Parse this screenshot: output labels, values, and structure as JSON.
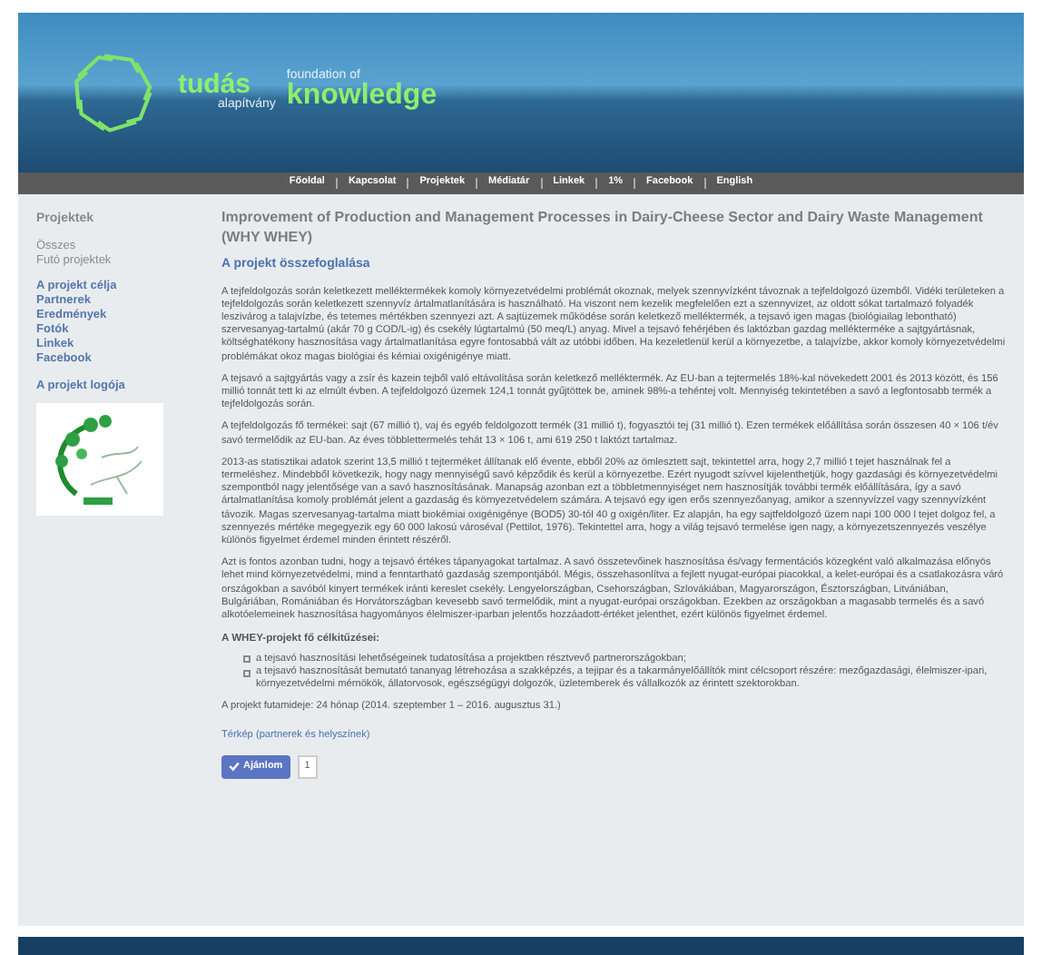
{
  "header": {
    "logo": {
      "word_1": "tudás",
      "word_2": "alapítvány",
      "word_3": "foundation of",
      "word_4": "knowledge"
    }
  },
  "nav": [
    {
      "label": "Főoldal"
    },
    {
      "label": "Kapcsolat"
    },
    {
      "label": "Projektek"
    },
    {
      "label": "Médiatár"
    },
    {
      "label": "Linkek"
    },
    {
      "label": "1%"
    },
    {
      "label": "Facebook"
    },
    {
      "label": "English"
    }
  ],
  "sidebar": {
    "title": "Projektek",
    "groups": [
      [
        "Összes",
        "Futó projektek"
      ],
      [
        "A projekt célja",
        "Partnerek",
        "Eredmények",
        "Fotók",
        "Linkek",
        "Facebook"
      ]
    ],
    "logo_title": "A projekt logója"
  },
  "article": {
    "title": "Improvement of Production and Management Processes in Dairy-Cheese Sector and Dairy Waste Management (WHY WHEY)",
    "subtitle": "A projekt összefoglalása",
    "paragraphs": [
      "A tejfeldolgozás során keletkezett melléktermékek komoly környezetvédelmi problémát okoznak, melyek szennyvízként távoznak a tejfeldolgozó üzemből. Vidéki területeken a tejfeldolgozás során keletkezett szennyvíz ártalmatlanítására is használható. Ha viszont nem kezelik megfelelően ezt a szennyvizet, az oldott sókat tartalmazó folyadék leszivárog a talajvízbe, és tetemes mértékben szennyezi azt. A sajtüzemek működése során keletkező melléktermék, a tejsavó igen magas (biológiailag lebontható) szervesanyag-tartalmú (akár 70 g COD/L-ig) és csekély lúgtartalmú (50 meq/L) anyag. Mivel a tejsavó fehérjében és laktózban gazdag mellékterméke a sajtgyártásnak, költséghatékony hasznosítása vagy ártalmatlanítása egyre fontosabbá vált az utóbbi időben. Ha kezeletlenül kerül a környezetbe, a talajvízbe, akkor komoly környezetvédelmi problémákat okoz magas biológiai és kémiai oxigénigénye miatt.",
      "A tejsavó a sajtgyártás vagy a zsír és kazein tejből való eltávolítása során keletkező melléktermék. Az EU-ban a tejtermelés 18%-kal növekedett 2001 és 2013 között, és 156 millió tonnát tett ki az elmúlt évben. A tejfeldolgozó üzemek 124,1 tonnát gyűjtöttek be, aminek 98%-a tehéntej volt. Mennyiség tekintetében a savó a legfontosabb termék a tejfeldolgozás során.",
      "A tejfeldolgozás fő termékei: sajt (67 millió t), vaj és egyéb feldolgozott termék (31 millió t), fogyasztói tej (31 millió t). Ezen termékek előállítása során összesen 40 × 106 t/év savó termelődik az EU-ban. Az éves többlettermelés tehát 13 × 106 t, ami 619 250 t laktózt tartalmaz.",
      "2013-as statisztikai adatok szerint 13,5 millió t tejterméket állítanak elő évente, ebből 20% az ömlesztett sajt, tekintettel arra, hogy 2,7 millió t tejet használnak fel a termeléshez. Mindebből következik, hogy nagy mennyiségű savó képződik és kerül a környezetbe. Ezért nyugodt szívvel kijelenthetjük, hogy gazdasági és környezetvédelmi szempontból nagy jelentősége van a savó hasznosításának. Manapság azonban ezt a többletmennyiséget nem hasznosítják további termék előállítására, így a savó ártalmatlanítása komoly problémát jelent a gazdaság és környezetvédelem számára. A tejsavó egy igen erős szennyezőanyag, amikor a szennyvízzel vagy szennyvízként távozik. Magas szervesanyag-tartalma miatt biokémiai oxigénigénye (BOD5) 30-tól 40 g oxigén/liter. Ez alapján, ha egy sajtfeldolgozó üzem napi 100 000 l tejet dolgoz fel, a szennyezés mértéke megegyezik egy 60 000 lakosú városéval (Pettilot, 1976). Tekintettel arra, hogy a világ tejsavó termelése igen nagy, a környezetszennyezés veszélye különös figyelmet érdemel minden érintett részéről.",
      "Azt is fontos azonban tudni, hogy a tejsavó értékes tápanyagokat tartalmaz. A savó összetevőinek hasznosítása és/vagy fermentációs közegként való alkalmazása előnyös lehet mind környezetvédelmi, mind a fenntartható gazdaság szempontjából. Mégis, összehasonlítva a fejlett nyugat-európai piacokkal, a kelet-európai és a csatlakozásra váró országokban a savóból kinyert termékek iránti kereslet csekély. Lengyelországban, Csehországban, Szlovákiában, Magyarországon, Észtországban, Litvániában, Bulgáriában, Romániában és Horvátországban kevesebb savó termelődik, mint a nyugat-európai országokban. Ezekben az országokban a magasabb termelés és a savó alkotóelemeinek hasznosítása hagyományos élelmiszer-iparban jelentős hozzáadott-értéket jelenthet, ezért különös figyelmet érdemel."
    ],
    "goals_title": "A WHEY-projekt fő célkitűzései:",
    "goals": [
      "a tejsavó hasznosítási lehetőségeinek tudatosítása a projektben résztvevő partnerországokban;",
      "a tejsavó hasznosítását bemutató tananyag létrehozása a szakképzés, a tejipar és a takarmányelőállítók mint célcsoport részére: mezőgazdasági, élelmiszer-ipari, környezetvédelmi mérnökök, állatorvosok, egészségügyi dolgozók, üzletemberek és vállalkozók az érintett szektorokban."
    ],
    "duration": "A projekt futamideje: 24 hónap (2014. szeptember 1 – 2016. augusztus 31.)",
    "map_link": "Térkép (partnerek és helyszínek)",
    "like": {
      "label": "Ajánlom",
      "count": "1"
    }
  }
}
